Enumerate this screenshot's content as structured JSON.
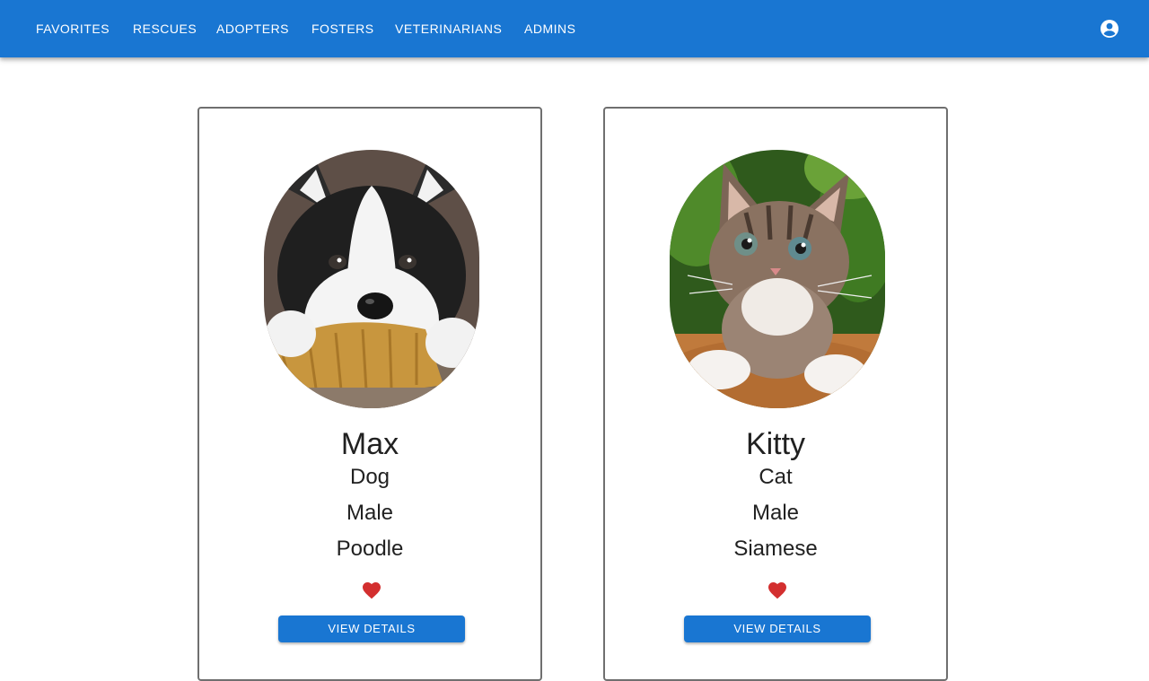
{
  "nav": {
    "items": [
      {
        "label": "FAVORITES"
      },
      {
        "label": "RESCUES"
      },
      {
        "label": "ADOPTERS"
      },
      {
        "label": "FOSTERS"
      },
      {
        "label": "VETERINARIANS"
      },
      {
        "label": "ADMINS"
      }
    ],
    "account_icon": "account-circle-icon"
  },
  "pets": [
    {
      "name": "Max",
      "species": "Dog",
      "gender": "Male",
      "breed": "Poodle",
      "favorite": true,
      "button_label": "VIEW DETAILS",
      "photo": "husky puppy chewing a toy"
    },
    {
      "name": "Kitty",
      "species": "Cat",
      "gender": "Male",
      "breed": "Siamese",
      "favorite": true,
      "button_label": "VIEW DETAILS",
      "photo": "tabby kitten"
    }
  ],
  "colors": {
    "primary": "#1976d2",
    "heart": "#d32f2f",
    "text": "#212121"
  }
}
